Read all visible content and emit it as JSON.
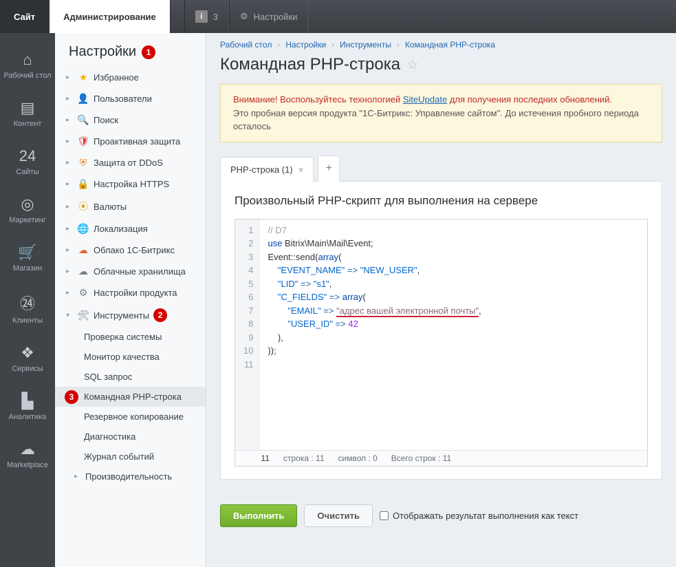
{
  "topbar": {
    "site": "Сайт",
    "admin": "Администрирование",
    "info_count": "3",
    "settings": "Настройки"
  },
  "rail": [
    {
      "icon": "⌂",
      "label": "Рабочий стол"
    },
    {
      "icon": "▤",
      "label": "Контент"
    },
    {
      "icon": "24",
      "label": "Сайты"
    },
    {
      "icon": "◎",
      "label": "Маркетинг"
    },
    {
      "icon": "🛒",
      "label": "Магазин"
    },
    {
      "icon": "㉔",
      "label": "Клиенты"
    },
    {
      "icon": "❖",
      "label": "Сервисы"
    },
    {
      "icon": "▙",
      "label": "Аналитика"
    },
    {
      "icon": "☁",
      "label": "Marketplace"
    }
  ],
  "sidebar": {
    "title": "Настройки",
    "badge_1": "1",
    "badge_2": "2",
    "badge_3": "3",
    "items": [
      {
        "icon": "★",
        "cls": "star-y",
        "label": "Избранное"
      },
      {
        "icon": "👤",
        "cls": "user-b",
        "label": "Пользователи"
      },
      {
        "icon": "🔍",
        "cls": "search-g",
        "label": "Поиск"
      },
      {
        "icon": "🛡",
        "cls": "shield-r",
        "label": "Проактивная защита"
      },
      {
        "icon": "⛨",
        "cls": "shield-o",
        "label": "Защита от DDoS"
      },
      {
        "icon": "🔒",
        "cls": "lock-b",
        "label": "Настройка HTTPS"
      },
      {
        "icon": "⦿",
        "cls": "coin-y",
        "label": "Валюты"
      },
      {
        "icon": "🌐",
        "cls": "globe-b",
        "label": "Локализация"
      },
      {
        "icon": "☁",
        "cls": "cloud-o",
        "label": "Облако 1С-Битрикс"
      },
      {
        "icon": "☁",
        "cls": "cloud-g",
        "label": "Облачные хранилища"
      },
      {
        "icon": "⚙",
        "cls": "gear-g",
        "label": "Настройки продукта"
      },
      {
        "icon": "🛠",
        "cls": "tool-g",
        "label": "Инструменты"
      }
    ],
    "sub": [
      "Проверка системы",
      "Монитор качества",
      "SQL запрос",
      "Командная PHP-строка",
      "Резервное копирование",
      "Диагностика",
      "Журнал событий",
      "Производительность"
    ],
    "active_sub_index": 3
  },
  "crumbs": [
    "Рабочий стол",
    "Настройки",
    "Инструменты",
    "Командная PHP-строка"
  ],
  "page_title": "Командная PHP-строка",
  "alert": {
    "warn": "Внимание! Воспользуйтесь технологией ",
    "link": "SiteUpdate",
    "warn2": " для получения последних обновлений.",
    "line2": "Это пробная версия продукта \"1С-Битрикс: Управление сайтом\". До истечения пробного периода осталось"
  },
  "tab": {
    "label": "PHP-строка (1)"
  },
  "panel_title": "Произвольный PHP-скрипт для выполнения на сервере",
  "code": {
    "lines": [
      {
        "n": "1",
        "html": "<span class='c-cm'>// D7</span>"
      },
      {
        "n": "2",
        "html": "<span class='c-kw'>use</span> Bitrix\\Main\\Mail\\Event;"
      },
      {
        "n": "3",
        "html": "Event::send(<span class='c-kw'>array</span>("
      },
      {
        "n": "4",
        "html": "    <span class='c-str'>\"EVENT_NAME\"</span> <span class='c-arr'>=&gt;</span> <span class='c-str'>\"NEW_USER\"</span>,"
      },
      {
        "n": "5",
        "html": "    <span class='c-str'>\"LID\"</span> <span class='c-arr'>=&gt;</span> <span class='c-str'>\"s1\"</span>,"
      },
      {
        "n": "6",
        "html": "    <span class='c-str'>\"C_FIELDS\"</span> <span class='c-arr'>=&gt;</span> <span class='c-kw'>array</span>("
      },
      {
        "n": "7",
        "html": "        <span class='c-str'>\"EMAIL\"</span> <span class='c-arr'>=&gt;</span> <span class='c-und'>\"адрес вашей электронной почты\"</span>,"
      },
      {
        "n": "8",
        "html": "        <span class='c-str'>\"USER_ID\"</span> <span class='c-arr'>=&gt;</span> <span class='c-num'>42</span>"
      },
      {
        "n": "9",
        "html": "    ),"
      },
      {
        "n": "10",
        "html": "));"
      },
      {
        "n": "11",
        "html": ""
      }
    ]
  },
  "statusbar": {
    "cur": "11",
    "line": "строка : 11",
    "col": "символ : 0",
    "total": "Всего строк : 11"
  },
  "actions": {
    "run": "Выполнить",
    "clear": "Очистить",
    "chk": "Отображать результат выполнения как текст"
  }
}
